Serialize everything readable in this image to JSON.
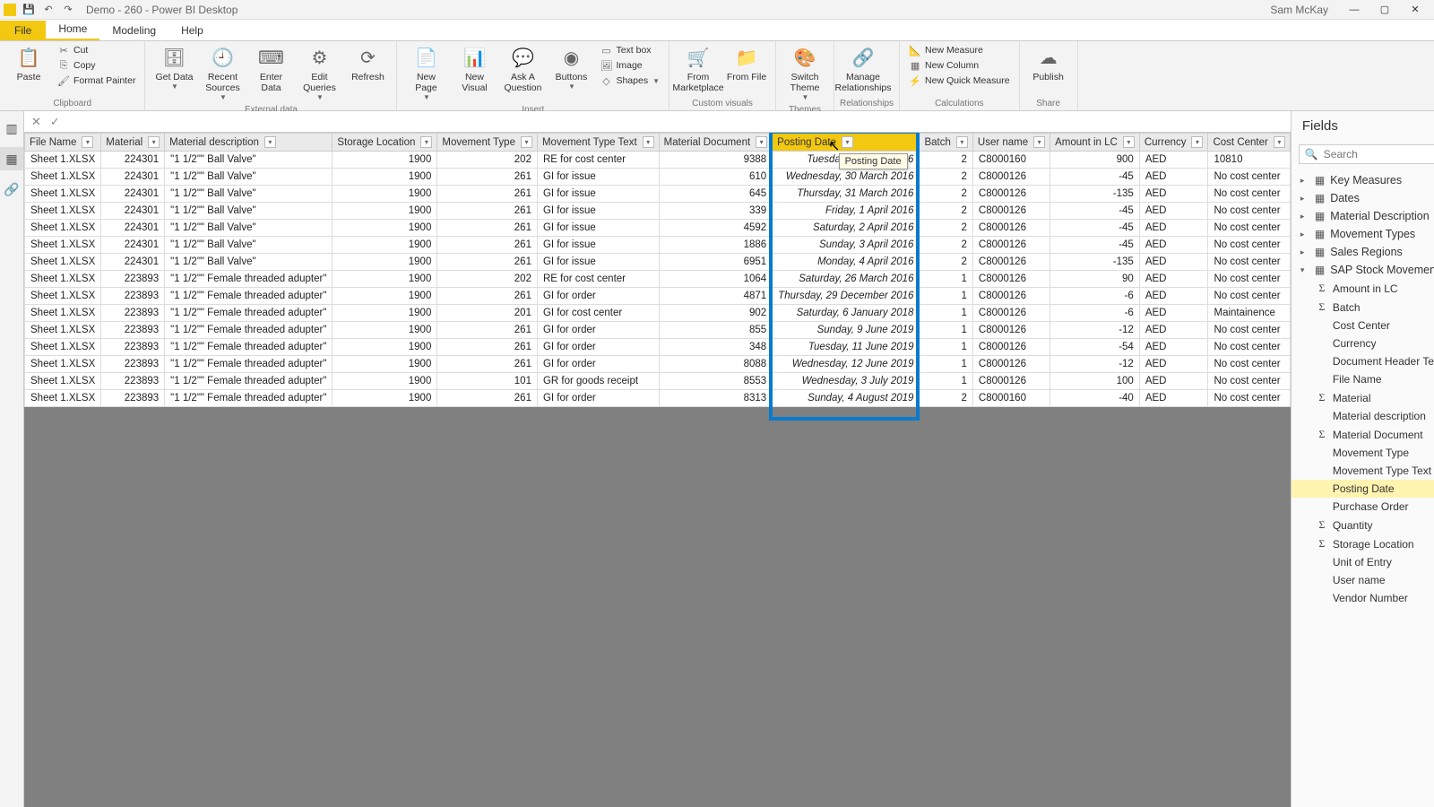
{
  "titlebar": {
    "app_title": "Demo - 260 - Power BI Desktop",
    "username": "Sam McKay"
  },
  "menu": {
    "file": "File",
    "home": "Home",
    "modeling": "Modeling",
    "help": "Help"
  },
  "ribbon": {
    "clipboard": {
      "label": "Clipboard",
      "paste": "Paste",
      "cut": "Cut",
      "copy": "Copy",
      "format_painter": "Format Painter"
    },
    "external": {
      "label": "External data",
      "get_data": "Get Data",
      "recent_sources": "Recent Sources",
      "enter_data": "Enter Data",
      "edit_queries": "Edit Queries",
      "refresh": "Refresh"
    },
    "insert": {
      "label": "Insert",
      "new_page": "New Page",
      "new_visual": "New Visual",
      "ask": "Ask A Question",
      "buttons": "Buttons",
      "textbox": "Text box",
      "image": "Image",
      "shapes": "Shapes"
    },
    "custom": {
      "label": "Custom visuals",
      "marketplace": "From Marketplace",
      "file": "From File"
    },
    "themes": {
      "label": "Themes",
      "switch": "Switch Theme"
    },
    "relationships": {
      "label": "Relationships",
      "manage": "Manage Relationships"
    },
    "calculations": {
      "label": "Calculations",
      "new_measure": "New Measure",
      "new_column": "New Column",
      "new_quick": "New Quick Measure"
    },
    "share": {
      "label": "Share",
      "publish": "Publish"
    }
  },
  "columns": [
    "File Name",
    "Material",
    "Material description",
    "Storage Location",
    "Movement Type",
    "Movement Type Text",
    "Material Document",
    "Posting Date",
    "Batch",
    "User name",
    "Amount in LC",
    "Currency",
    "Cost Center"
  ],
  "rows": [
    [
      "Sheet 1.XLSX",
      "224301",
      "\"1 1/2\"\" Ball Valve\"",
      "1900",
      "202",
      "RE for cost center",
      "9388",
      "Tuesday, 5 March 2016",
      "2",
      "C8000160",
      "900",
      "AED",
      "10810"
    ],
    [
      "Sheet 1.XLSX",
      "224301",
      "\"1 1/2\"\" Ball Valve\"",
      "1900",
      "261",
      "GI for issue",
      "610",
      "Wednesday, 30 March 2016",
      "2",
      "C8000126",
      "-45",
      "AED",
      "No cost center"
    ],
    [
      "Sheet 1.XLSX",
      "224301",
      "\"1 1/2\"\" Ball Valve\"",
      "1900",
      "261",
      "GI for issue",
      "645",
      "Thursday, 31 March 2016",
      "2",
      "C8000126",
      "-135",
      "AED",
      "No cost center"
    ],
    [
      "Sheet 1.XLSX",
      "224301",
      "\"1 1/2\"\" Ball Valve\"",
      "1900",
      "261",
      "GI for issue",
      "339",
      "Friday, 1 April 2016",
      "2",
      "C8000126",
      "-45",
      "AED",
      "No cost center"
    ],
    [
      "Sheet 1.XLSX",
      "224301",
      "\"1 1/2\"\" Ball Valve\"",
      "1900",
      "261",
      "GI for issue",
      "4592",
      "Saturday, 2 April 2016",
      "2",
      "C8000126",
      "-45",
      "AED",
      "No cost center"
    ],
    [
      "Sheet 1.XLSX",
      "224301",
      "\"1 1/2\"\" Ball Valve\"",
      "1900",
      "261",
      "GI for issue",
      "1886",
      "Sunday, 3 April 2016",
      "2",
      "C8000126",
      "-45",
      "AED",
      "No cost center"
    ],
    [
      "Sheet 1.XLSX",
      "224301",
      "\"1 1/2\"\" Ball Valve\"",
      "1900",
      "261",
      "GI for issue",
      "6951",
      "Monday, 4 April 2016",
      "2",
      "C8000126",
      "-135",
      "AED",
      "No cost center"
    ],
    [
      "Sheet 1.XLSX",
      "223893",
      "\"1 1/2\"\" Female threaded adupter\"",
      "1900",
      "202",
      "RE for cost center",
      "1064",
      "Saturday, 26 March 2016",
      "1",
      "C8000126",
      "90",
      "AED",
      "No cost center"
    ],
    [
      "Sheet 1.XLSX",
      "223893",
      "\"1 1/2\"\" Female threaded adupter\"",
      "1900",
      "261",
      "GI for order",
      "4871",
      "Thursday, 29 December 2016",
      "1",
      "C8000126",
      "-6",
      "AED",
      "No cost center"
    ],
    [
      "Sheet 1.XLSX",
      "223893",
      "\"1 1/2\"\" Female threaded adupter\"",
      "1900",
      "201",
      "GI for cost center",
      "902",
      "Saturday, 6 January 2018",
      "1",
      "C8000126",
      "-6",
      "AED",
      "Maintainence"
    ],
    [
      "Sheet 1.XLSX",
      "223893",
      "\"1 1/2\"\" Female threaded adupter\"",
      "1900",
      "261",
      "GI for order",
      "855",
      "Sunday, 9 June 2019",
      "1",
      "C8000126",
      "-12",
      "AED",
      "No cost center"
    ],
    [
      "Sheet 1.XLSX",
      "223893",
      "\"1 1/2\"\" Female threaded adupter\"",
      "1900",
      "261",
      "GI for order",
      "348",
      "Tuesday, 11 June 2019",
      "1",
      "C8000126",
      "-54",
      "AED",
      "No cost center"
    ],
    [
      "Sheet 1.XLSX",
      "223893",
      "\"1 1/2\"\" Female threaded adupter\"",
      "1900",
      "261",
      "GI for order",
      "8088",
      "Wednesday, 12 June 2019",
      "1",
      "C8000126",
      "-12",
      "AED",
      "No cost center"
    ],
    [
      "Sheet 1.XLSX",
      "223893",
      "\"1 1/2\"\" Female threaded adupter\"",
      "1900",
      "101",
      "GR for goods receipt",
      "8553",
      "Wednesday, 3 July 2019",
      "1",
      "C8000126",
      "100",
      "AED",
      "No cost center"
    ],
    [
      "Sheet 1.XLSX",
      "223893",
      "\"1 1/2\"\" Female threaded adupter\"",
      "1900",
      "261",
      "GI for order",
      "8313",
      "Sunday, 4 August 2019",
      "2",
      "C8000160",
      "-40",
      "AED",
      "No cost center"
    ]
  ],
  "tooltip": "Posting Date",
  "fields_pane": {
    "title": "Fields",
    "search_placeholder": "Search",
    "tables": [
      {
        "name": "Key Measures",
        "expanded": false
      },
      {
        "name": "Dates",
        "expanded": false
      },
      {
        "name": "Material Description",
        "expanded": false
      },
      {
        "name": "Movement Types",
        "expanded": false
      },
      {
        "name": "Sales Regions",
        "expanded": false
      },
      {
        "name": "SAP Stock Movements",
        "expanded": true,
        "fields": [
          {
            "name": "Amount in LC",
            "sigma": true
          },
          {
            "name": "Batch",
            "sigma": true
          },
          {
            "name": "Cost Center",
            "sigma": false
          },
          {
            "name": "Currency",
            "sigma": false
          },
          {
            "name": "Document Header Text",
            "sigma": false
          },
          {
            "name": "File Name",
            "sigma": false
          },
          {
            "name": "Material",
            "sigma": true
          },
          {
            "name": "Material description",
            "sigma": false
          },
          {
            "name": "Material Document",
            "sigma": true
          },
          {
            "name": "Movement Type",
            "sigma": false
          },
          {
            "name": "Movement Type Text",
            "sigma": false
          },
          {
            "name": "Posting Date",
            "sigma": false,
            "selected": true
          },
          {
            "name": "Purchase Order",
            "sigma": false
          },
          {
            "name": "Quantity",
            "sigma": true
          },
          {
            "name": "Storage Location",
            "sigma": true
          },
          {
            "name": "Unit of Entry",
            "sigma": false
          },
          {
            "name": "User name",
            "sigma": false
          },
          {
            "name": "Vendor Number",
            "sigma": false
          }
        ]
      }
    ]
  }
}
